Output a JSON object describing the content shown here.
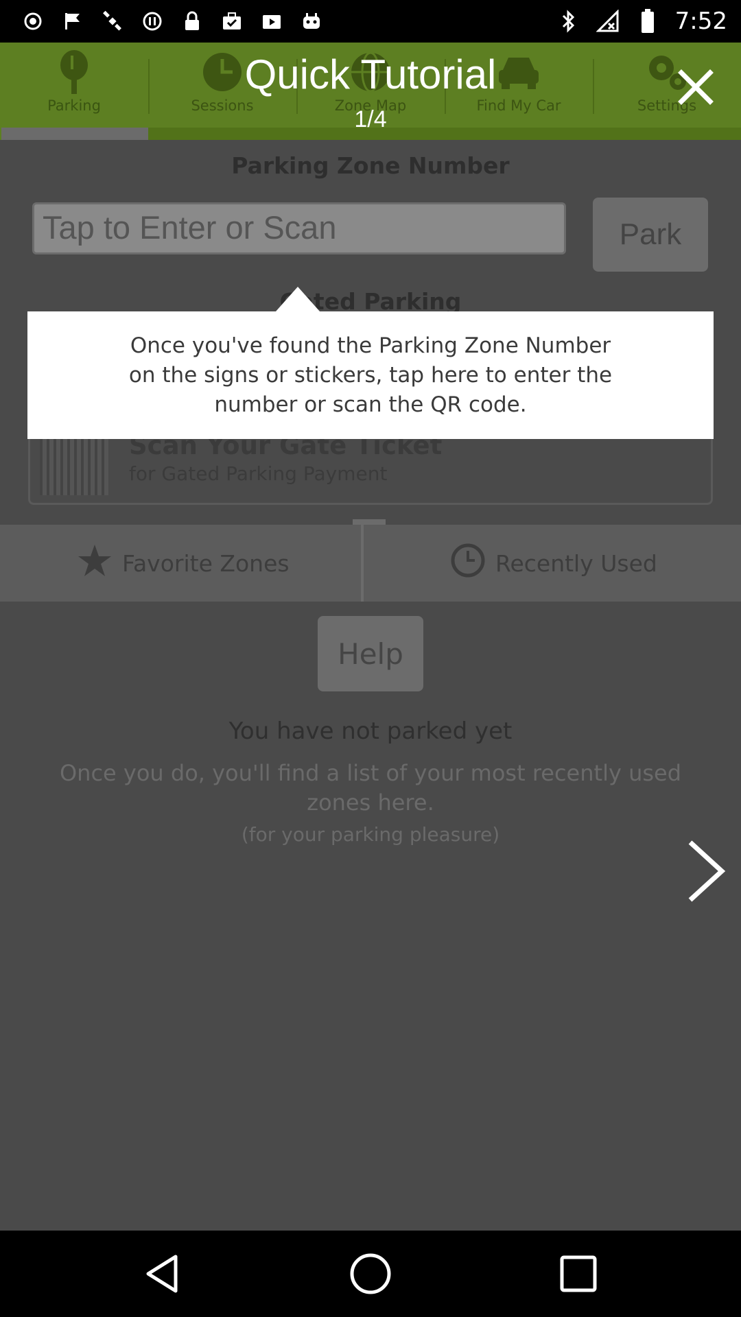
{
  "status_bar": {
    "time": "7:52",
    "left_icons": [
      "notification-dot-icon",
      "flag-icon",
      "satellite-icon",
      "circle-pause-icon",
      "lock-icon",
      "briefcase-check-icon",
      "play-box-icon",
      "robot-icon"
    ],
    "right_icons": [
      "bluetooth-icon",
      "signal-off-icon",
      "battery-icon"
    ]
  },
  "tabs": [
    {
      "label": "Parking",
      "icon": "parking-meter-icon"
    },
    {
      "label": "Sessions",
      "icon": "clock-icon"
    },
    {
      "label": "Zone Map",
      "icon": "globe-icon"
    },
    {
      "label": "Find My Car",
      "icon": "car-icon"
    },
    {
      "label": "Settings",
      "icon": "gears-icon"
    }
  ],
  "parking": {
    "zone_title": "Parking Zone Number",
    "zone_input_placeholder": "Tap to Enter or Scan",
    "park_label": "Park",
    "gated_title": "Gated Parking",
    "gate_title": "Scan Your Gate Ticket",
    "gate_subtitle": "for Gated Parking Payment"
  },
  "zones_bar": {
    "favorites_label": "Favorite Zones",
    "recent_label": "Recently Used"
  },
  "empty_state": {
    "help_label": "Help",
    "title": "You have not parked yet",
    "description": "Once you do, you'll find a list of your most recently used zones here.",
    "subtext": "(for your parking pleasure)"
  },
  "tutorial": {
    "title": "Quick Tutorial",
    "page": "1/4",
    "tooltip": "Once you've found the Parking Zone Number on the signs or stickers, tap here to enter the number or scan the QR code."
  },
  "colors": {
    "tab_bar": "#5d7f22",
    "overlay": "#4a4a4a",
    "tooltip": "#ffffff"
  }
}
